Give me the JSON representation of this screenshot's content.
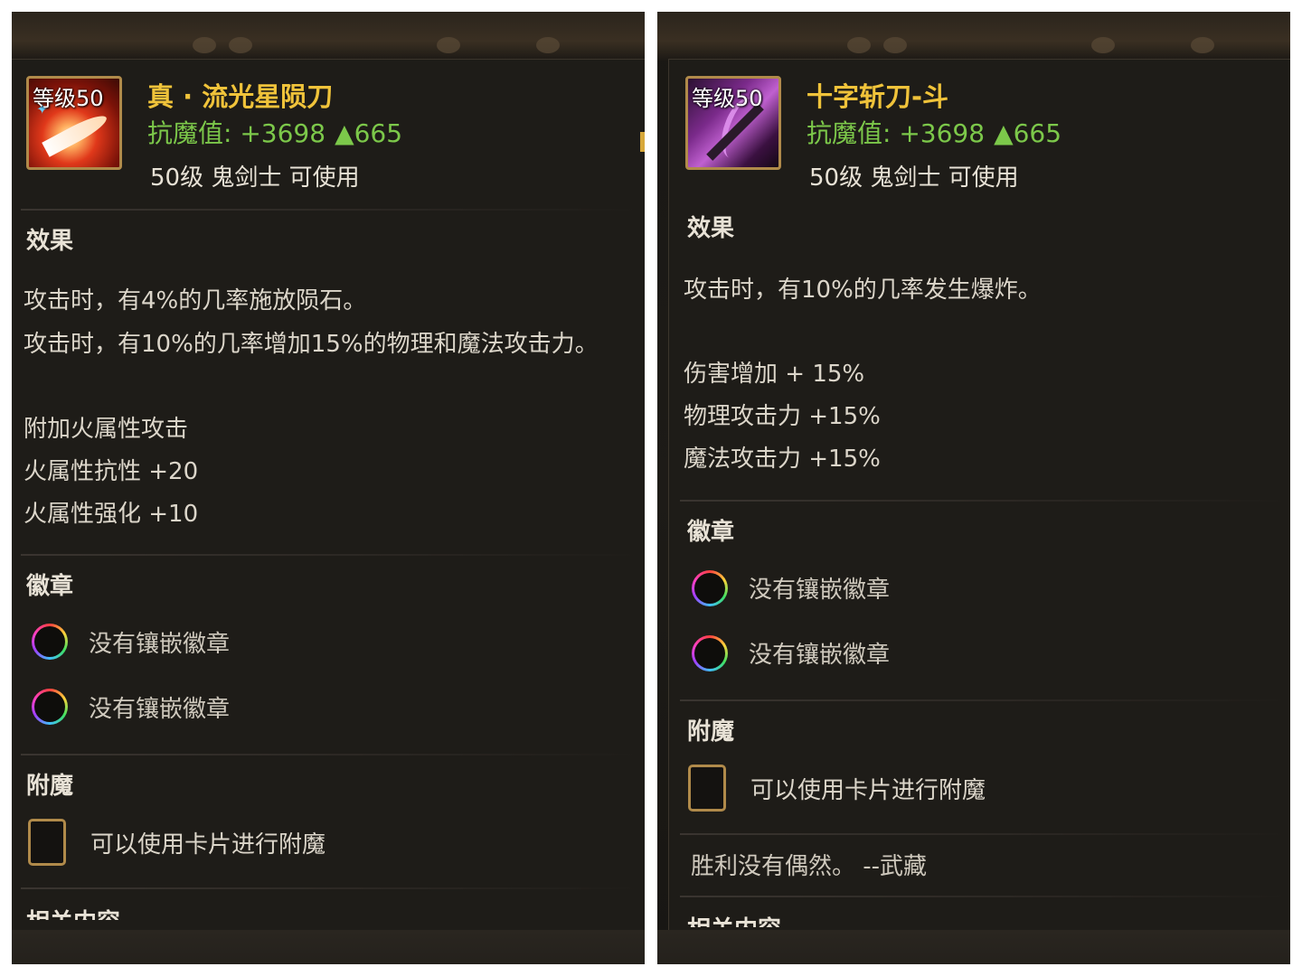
{
  "left": {
    "item": {
      "level_badge": "等级50",
      "name": "真 · 流光星陨刀",
      "stat_label": "抗魔值: +3698",
      "stat_up": "▲665",
      "usable": "50级 鬼剑士 可使用"
    },
    "effect": {
      "title": "效果",
      "lines": [
        "攻击时，有4%的几率施放陨石。",
        "攻击时，有10%的几率增加15%的物理和魔法攻击力。"
      ],
      "bonus": [
        "附加火属性攻击",
        "火属性抗性 +20",
        "火属性强化 +10"
      ]
    },
    "emblem": {
      "title": "徽章",
      "sockets": [
        "没有镶嵌徽章",
        "没有镶嵌徽章"
      ]
    },
    "enchant": {
      "title": "附魔",
      "text": "可以使用卡片进行附魔"
    },
    "related_cut": "相关内容"
  },
  "right": {
    "item": {
      "level_badge": "等级50",
      "name": "十字斩刀-斗",
      "stat_label": "抗魔值: +3698",
      "stat_up": "▲665",
      "usable": "50级 鬼剑士 可使用"
    },
    "effect": {
      "title": "效果",
      "lines": [
        "攻击时，有10%的几率发生爆炸。"
      ],
      "bonus": [
        "伤害增加 + 15%",
        "物理攻击力 +15%",
        "魔法攻击力 +15%"
      ]
    },
    "emblem": {
      "title": "徽章",
      "sockets": [
        "没有镶嵌徽章",
        "没有镶嵌徽章"
      ]
    },
    "enchant": {
      "title": "附魔",
      "text": "可以使用卡片进行附魔"
    },
    "quote": "胜利没有偶然。 --武藏",
    "related_cut": "相关内容"
  },
  "colors": {
    "name": "#f0c33a",
    "stat": "#7cc84a",
    "frame": "#b08a4a"
  },
  "icons": {
    "left_item": "fire-blade-icon",
    "right_item": "cross-blade-icon",
    "socket": "emblem-socket-icon",
    "card": "card-slot-icon"
  }
}
